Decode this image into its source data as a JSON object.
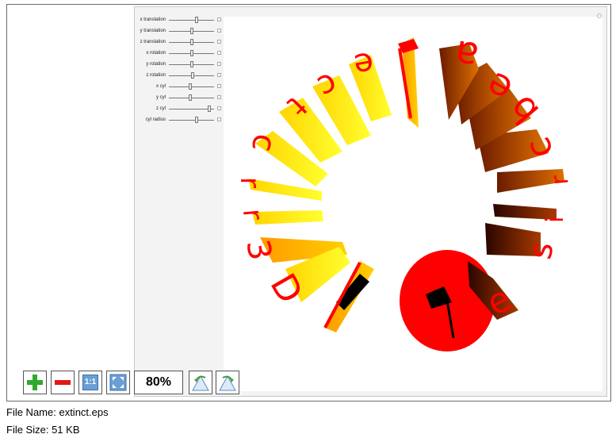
{
  "controls": {
    "sliders": [
      {
        "label": "x translation",
        "value": 0.62
      },
      {
        "label": "y translation",
        "value": 0.5
      },
      {
        "label": "z translation",
        "value": 0.5
      },
      {
        "label": "x rotation",
        "value": 0.5
      },
      {
        "label": "y rotation",
        "value": 0.5
      },
      {
        "label": "z rotation",
        "value": 0.52
      },
      {
        "label": "x cyl",
        "value": 0.48
      },
      {
        "label": "y cyl",
        "value": 0.48
      },
      {
        "label": "z cyl",
        "value": 0.92
      },
      {
        "label": "cyl radius",
        "value": 0.62
      }
    ]
  },
  "toolbar": {
    "zoom_in_icon": "plus-icon",
    "zoom_out_icon": "minus-icon",
    "actual_size_label": "1:1",
    "fit_icon": "fit-to-window-icon",
    "zoom_level": "80%",
    "rotate_left_icon": "rotate-left-icon",
    "rotate_right_icon": "rotate-right-icon"
  },
  "scene": {
    "letters": [
      "D",
      "3",
      "r",
      "r",
      "r",
      "c",
      "t",
      "c",
      "e",
      "p",
      "a",
      "e",
      "b",
      "c",
      "r",
      "i",
      "s",
      "e"
    ],
    "colors": {
      "red": "#ff0000",
      "yellow": "#ffee00",
      "orange": "#ff9900",
      "dark": "#3a0800"
    }
  },
  "file_info": {
    "name_label": "File Name: extinct.eps",
    "size_label": "File Size: 51 KB"
  }
}
